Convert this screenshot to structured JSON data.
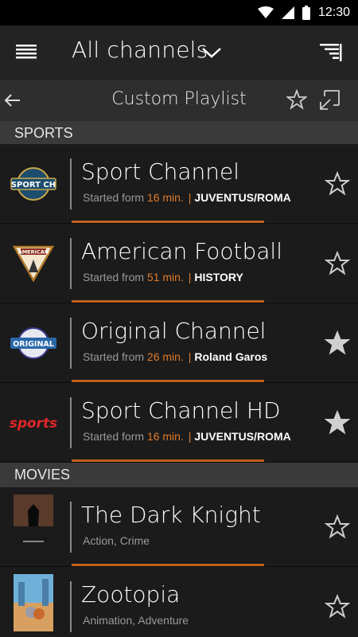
{
  "status": {
    "time": "12:30",
    "icons": [
      "wifi-icon",
      "signal-icon",
      "battery-icon"
    ]
  },
  "toolbar": {
    "title": "All channels",
    "menu_icon": "hamburger-icon",
    "dropdown_icon": "chevron-down-icon",
    "sort_icon": "sort-list-icon"
  },
  "subbar": {
    "title": "Custom Playlist",
    "back_icon": "arrow-left-icon",
    "star_icon": "star-outline-icon",
    "minimize_icon": "minimize-window-icon"
  },
  "sections": [
    {
      "label": "SPORTS",
      "rows": [
        {
          "name": "Sport Channel",
          "started_label": "Started form",
          "minutes": "16 min.",
          "program": "JUVENTUS/ROMA",
          "favorite": false,
          "logo": "SPORT CH",
          "progress": 0.6
        },
        {
          "name": "American Football",
          "started_label": "Started from",
          "minutes": "51 min.",
          "program": "HISTORY",
          "favorite": false,
          "logo": "AMERICAN",
          "progress": 0.6
        },
        {
          "name": "Original Channel",
          "started_label": "Started from",
          "minutes": "26 min.",
          "program": "Roland Garos",
          "favorite": true,
          "logo": "ORIGINAL",
          "progress": 0.6
        },
        {
          "name": "Sport Channel HD",
          "started_label": "Started form",
          "minutes": "16 min.",
          "program": "JUVENTUS/ROMA",
          "favorite": true,
          "logo": "sports",
          "progress": 0.6
        }
      ]
    },
    {
      "label": "MOVIES",
      "rows": [
        {
          "name": "The Dark Knight",
          "genre": "Action, Crime",
          "favorite": false,
          "progress": 0.6
        },
        {
          "name": "Zootopia",
          "genre": "Animation, Adventure",
          "favorite": false,
          "progress": 0.6
        }
      ]
    }
  ],
  "colors": {
    "accent": "#e07b2a",
    "progress": "#c0601f",
    "background": "#1b1b1b",
    "section": "#3a3a3a",
    "toolbar": "#232323"
  }
}
